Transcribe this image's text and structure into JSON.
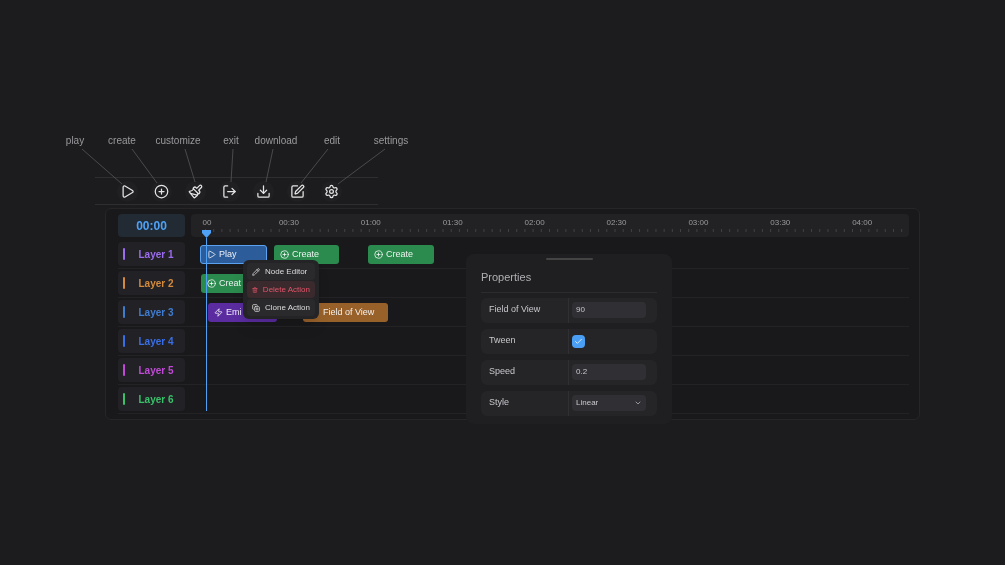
{
  "toolbar": [
    {
      "kind": "play",
      "label": "play"
    },
    {
      "kind": "create",
      "label": "create"
    },
    {
      "kind": "customize",
      "label": "customize"
    },
    {
      "kind": "exit",
      "label": "exit"
    },
    {
      "kind": "download",
      "label": "download"
    },
    {
      "kind": "edit",
      "label": "edit"
    },
    {
      "kind": "settings",
      "label": "settings"
    }
  ],
  "timeline": {
    "time": "00:00",
    "ticks": [
      "00",
      "00:30",
      "01:00",
      "01:30",
      "02:00",
      "02:30",
      "03:00",
      "03:30",
      "04:00"
    ],
    "layers": [
      {
        "name": "Layer 1",
        "color": "#9b6cf0",
        "clips": [
          {
            "kind": "play",
            "label": "Play",
            "color": "#2d5c9a",
            "selected": true
          },
          {
            "kind": "create",
            "label": "Create",
            "color": "#2b8a4e",
            "selected": false
          },
          {
            "kind": "create",
            "label": "Create",
            "color": "#2b8a4e",
            "selected": false
          }
        ]
      },
      {
        "name": "Layer 2",
        "color": "#d48a3c",
        "clips": [
          {
            "kind": "create",
            "label": "Creat",
            "color": "#2b8a4e",
            "selected": false
          }
        ]
      },
      {
        "name": "Layer 3",
        "color": "#3f7cd0",
        "clips": [
          {
            "kind": "emit",
            "label": "Emi",
            "color": "#5a2ca0",
            "selected": false
          },
          {
            "kind": "none",
            "label": "Field of View",
            "color": "#98612a",
            "selected": false
          }
        ]
      },
      {
        "name": "Layer 4",
        "color": "#3a6ee6"
      },
      {
        "name": "Layer 5",
        "color": "#c04ad6"
      },
      {
        "name": "Layer 6",
        "color": "#38c06a"
      }
    ]
  },
  "context_menu": [
    {
      "kind": "edit",
      "label": "Node Editor",
      "selected": false
    },
    {
      "kind": "delete",
      "label": "Delete Action",
      "selected": true
    },
    {
      "kind": "clone",
      "label": "Clone Action",
      "selected": false
    }
  ],
  "properties": {
    "title": "Properties",
    "rows": [
      {
        "kind": "text",
        "label": "Field of View",
        "value": "90"
      },
      {
        "kind": "checkbox",
        "label": "Tween",
        "checked": true
      },
      {
        "kind": "text",
        "label": "Speed",
        "value": "0.2"
      },
      {
        "kind": "select",
        "label": "Style",
        "value": "Linear"
      }
    ]
  }
}
